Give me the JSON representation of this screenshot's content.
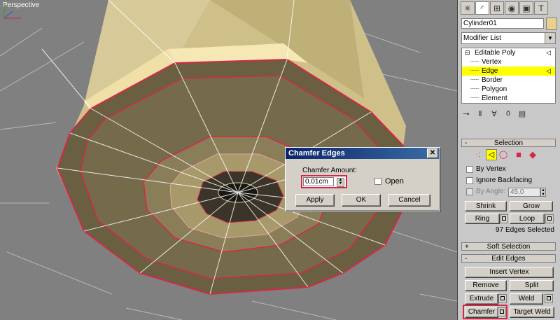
{
  "viewport": {
    "label": "Perspective"
  },
  "dialog": {
    "title": "Chamfer Edges",
    "close_glyph": "✕",
    "amount_label": "Chamfer Amount:",
    "amount_value": "0,01cm",
    "open_label": "Open",
    "apply_label": "Apply",
    "ok_label": "OK",
    "cancel_label": "Cancel"
  },
  "panel": {
    "tabs": [
      "create-icon",
      "modify-icon",
      "hierarchy-icon",
      "motion-icon",
      "display-icon",
      "utilities-icon"
    ],
    "object_name": "Cylinder01",
    "object_color": "#e8d18a",
    "modifier_list": "Modifier List",
    "stack": {
      "root": "Editable Poly",
      "items": [
        "Vertex",
        "Edge",
        "Border",
        "Polygon",
        "Element"
      ],
      "selected": "Edge"
    },
    "selection": {
      "title": "Selection",
      "by_vertex": "By Vertex",
      "ignore_backfacing": "Ignore Backfacing",
      "by_angle": "By Angle:",
      "angle_value": "45,0",
      "shrink": "Shrink",
      "grow": "Grow",
      "ring": "Ring",
      "loop": "Loop",
      "status": "97 Edges Selected"
    },
    "soft_selection": {
      "title": "Soft Selection"
    },
    "edit_edges": {
      "title": "Edit Edges",
      "insert_vertex": "Insert Vertex",
      "remove": "Remove",
      "split": "Split",
      "extrude": "Extrude",
      "weld": "Weld",
      "chamfer": "Chamfer",
      "target_weld": "Target Weld"
    },
    "rollout_signs": {
      "expanded": "-",
      "collapsed": "+"
    }
  },
  "colors": {
    "accent_highlight": "#d62747",
    "selected_row": "#ffff00",
    "title_bar": "#0a246a"
  }
}
